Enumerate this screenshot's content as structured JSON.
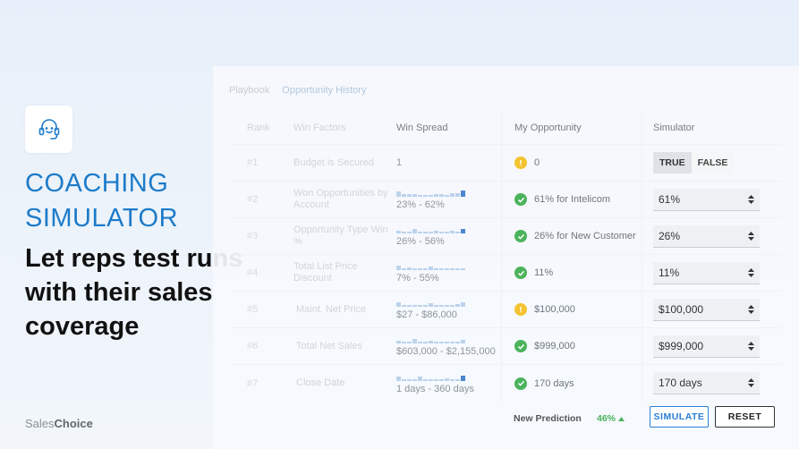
{
  "hero": {
    "title": "COACHING SIMULATOR",
    "tagline": "Let reps test runs with their sales coverage"
  },
  "brand": {
    "part1": "Sales",
    "part2": "Choice"
  },
  "tabs": [
    {
      "label": "Playbook",
      "active": false
    },
    {
      "label": "Opportunity History",
      "active": true
    }
  ],
  "table": {
    "headers": {
      "rank": "Rank",
      "factor": "Win Factors",
      "spread": "Win Spread",
      "myopp": "My Opportunity",
      "sim": "Simulator"
    },
    "rows": [
      {
        "rank": "#1",
        "factor": "Budget is Secured",
        "spread": "1",
        "status": "warn",
        "myopp": "0",
        "sim_type": "toggle",
        "true_label": "TRUE",
        "false_label": "FALSE"
      },
      {
        "rank": "#2",
        "factor": "Won Opportunities by Account",
        "spread": "23% - 62%",
        "status": "ok",
        "myopp": "61% for Intelicom",
        "sim_type": "stepper",
        "sim": "61%"
      },
      {
        "rank": "#3",
        "factor": "Opportunity Type Win %",
        "spread": "26% - 56%",
        "status": "ok",
        "myopp": "26% for New Customer",
        "sim_type": "stepper",
        "sim": "26%"
      },
      {
        "rank": "#4",
        "factor": "Total List Price Discount",
        "spread": "7% - 55%",
        "status": "ok",
        "myopp": "11%",
        "sim_type": "stepper",
        "sim": "11%"
      },
      {
        "rank": "#5",
        "factor": "Maint. Net Price",
        "spread": "$27 - $86,000",
        "status": "warn",
        "myopp": "$100,000",
        "sim_type": "stepper",
        "sim": "$100,000"
      },
      {
        "rank": "#6",
        "factor": "Total Net Sales",
        "spread": "$603,000 - $2,155,000",
        "status": "ok",
        "myopp": "$999,000",
        "sim_type": "stepper",
        "sim": "$999,000"
      },
      {
        "rank": "#7",
        "factor": "Close Date",
        "spread": "1 days - 360 days",
        "status": "ok",
        "myopp": "170 days",
        "sim_type": "stepper",
        "sim": "170 days"
      }
    ]
  },
  "footer": {
    "prediction_label": "New Prediction",
    "prediction_value": "46%",
    "simulate_label": "SIMULATE",
    "reset_label": "RESET"
  },
  "colors": {
    "accent": "#1d7bc9",
    "ok": "#4cb35d",
    "warn": "#f3c42f"
  }
}
